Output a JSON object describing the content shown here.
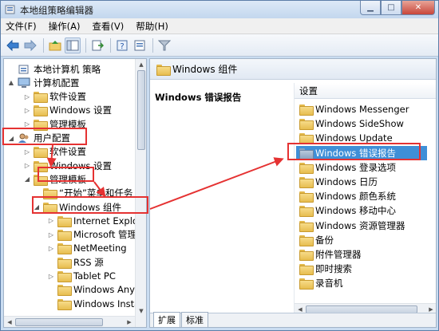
{
  "window": {
    "title": "本地组策略编辑器"
  },
  "menu": [
    "文件(F)",
    "操作(A)",
    "查看(V)",
    "帮助(H)"
  ],
  "tree": [
    {
      "label": "本地计算机 策略",
      "level": 0,
      "exp": "",
      "icon": "policy-icon"
    },
    {
      "label": "计算机配置",
      "level": 0,
      "exp": "▲",
      "icon": "computer-icon"
    },
    {
      "label": "软件设置",
      "level": 1,
      "exp": "▷",
      "icon": "folder-icon"
    },
    {
      "label": "Windows 设置",
      "level": 1,
      "exp": "▷",
      "icon": "folder-icon"
    },
    {
      "label": "管理模板",
      "level": 1,
      "exp": "▷",
      "icon": "folder-icon"
    },
    {
      "label": "用户配置",
      "level": 0,
      "exp": "◢",
      "icon": "user-icon"
    },
    {
      "label": "软件设置",
      "level": 1,
      "exp": "▷",
      "icon": "folder-icon"
    },
    {
      "label": "Windows 设置",
      "level": 1,
      "exp": "▷",
      "icon": "folder-icon"
    },
    {
      "label": "管理模板",
      "level": 1,
      "exp": "◢",
      "icon": "folder-icon"
    },
    {
      "label": "“开始”菜单和任务",
      "level": 2,
      "exp": "",
      "icon": "folder-icon"
    },
    {
      "label": "Windows 组件",
      "level": 2,
      "exp": "◢",
      "icon": "folder-icon"
    },
    {
      "label": "Internet Explor",
      "level": 3,
      "exp": "▷",
      "icon": "folder-icon"
    },
    {
      "label": "Microsoft 管理",
      "level": 3,
      "exp": "▷",
      "icon": "folder-icon"
    },
    {
      "label": "NetMeeting",
      "level": 3,
      "exp": "▷",
      "icon": "folder-icon"
    },
    {
      "label": "RSS 源",
      "level": 3,
      "exp": "",
      "icon": "folder-icon"
    },
    {
      "label": "Tablet PC",
      "level": 3,
      "exp": "▷",
      "icon": "folder-icon"
    },
    {
      "label": "Windows Anyti",
      "level": 3,
      "exp": "",
      "icon": "folder-icon"
    },
    {
      "label": "Windows Insta",
      "level": 3,
      "exp": "",
      "icon": "folder-icon"
    }
  ],
  "right_pane": {
    "header": "Windows 组件",
    "description_title": "Windows 错误报告",
    "column_header": "设置",
    "items": [
      "Windows Messenger",
      "Windows SideShow",
      "Windows Update",
      "Windows 错误报告",
      "Windows 登录选项",
      "Windows 日历",
      "Windows 颜色系统",
      "Windows 移动中心",
      "Windows 资源管理器",
      "备份",
      "附件管理器",
      "即时搜索",
      "录音机"
    ],
    "selected_index": 3,
    "tabs": [
      "扩展",
      "标准"
    ]
  }
}
